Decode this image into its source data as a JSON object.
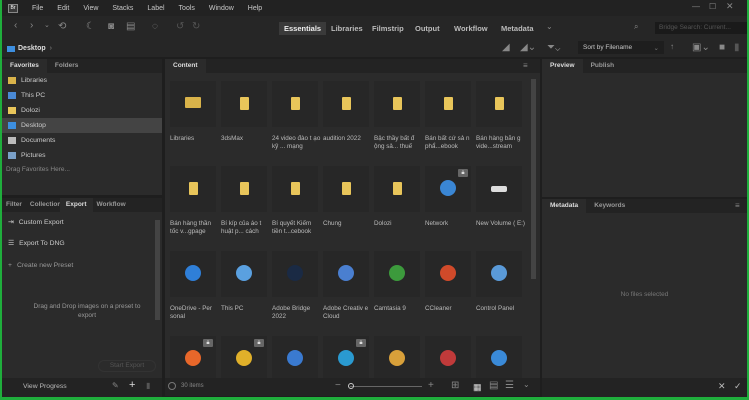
{
  "menu": [
    "File",
    "Edit",
    "View",
    "Stacks",
    "Label",
    "Tools",
    "Window",
    "Help"
  ],
  "workspaces": [
    "Essentials",
    "Libraries",
    "Filmstrip",
    "Output",
    "Workflow",
    "Metadata"
  ],
  "search_placeholder": "Bridge Search: Current...",
  "path": "Desktop",
  "sort": "Sort by Filename",
  "left_tabs": [
    "Favorites",
    "Folders"
  ],
  "favorites": [
    {
      "label": "Libraries",
      "color": "#d9b34a"
    },
    {
      "label": "This PC",
      "color": "#4a8ad6"
    },
    {
      "label": "Dolozi",
      "color": "#e8c55a"
    },
    {
      "label": "Desktop",
      "color": "#3d8fe0"
    },
    {
      "label": "Documents",
      "color": "#bbbbbb"
    },
    {
      "label": "Pictures",
      "color": "#7aa0c8"
    }
  ],
  "favorites_hint": "Drag Favorites Here...",
  "export_tabs": [
    "Filter",
    "Collection",
    "Export",
    "Workflow"
  ],
  "export_items": [
    "Custom Export",
    "Export To DNG",
    "Create new Preset"
  ],
  "export_hint": "Drag and Drop images on a preset to export",
  "start_export": "Start Export",
  "view_progress": "View Progress",
  "content_tab": "Content",
  "items": [
    {
      "label": "Libraries",
      "type": "libraries"
    },
    {
      "label": "3dsMax",
      "type": "folder"
    },
    {
      "label": "24 video đào t ạo kỹ ... mạng",
      "type": "folder"
    },
    {
      "label": "audition 2022",
      "type": "folder"
    },
    {
      "label": "Bậc thầy bất đ ộng sả... thuế",
      "type": "folder"
    },
    {
      "label": "Bán bất cứ sả n phẩ...ebook",
      "type": "folder"
    },
    {
      "label": "Bán hàng bằn g vide...stream",
      "type": "folder"
    },
    {
      "label": "Bán hàng thần tốc v...gpage",
      "type": "folder"
    },
    {
      "label": "Bí kíp của áo t huật p... cách",
      "type": "folder"
    },
    {
      "label": "Bí quyết Kiếm tiền t...cebook",
      "type": "folder"
    },
    {
      "label": "Chung",
      "type": "folder"
    },
    {
      "label": "Dolozi",
      "type": "folder"
    },
    {
      "label": "Network",
      "type": "app",
      "color": "#3a86d4",
      "lock": true
    },
    {
      "label": "New Volume ( E:)",
      "type": "drive"
    },
    {
      "label": "OneDrive - Per sonal",
      "type": "app",
      "color": "#2f7fd8"
    },
    {
      "label": "This PC",
      "type": "app",
      "color": "#5aa0e0"
    },
    {
      "label": "Adobe Bridge 2022",
      "type": "app",
      "color": "#1a2a44"
    },
    {
      "label": "Adobe Creativ e Cloud",
      "type": "app",
      "color": "#4a7fd0"
    },
    {
      "label": "Camtasia 9",
      "type": "app",
      "color": "#3c9a3c"
    },
    {
      "label": "CCleaner",
      "type": "app",
      "color": "#d04a2a"
    },
    {
      "label": "Control Panel",
      "type": "app",
      "color": "#5a9ad8"
    },
    {
      "label": "",
      "type": "app",
      "color": "#e8672a",
      "lock": true
    },
    {
      "label": "",
      "type": "app",
      "color": "#e0b02a",
      "lock": true
    },
    {
      "label": "",
      "type": "app",
      "color": "#3a7ad0"
    },
    {
      "label": "",
      "type": "app",
      "color": "#2a9ad0",
      "lock": true
    },
    {
      "label": "",
      "type": "app",
      "color": "#d8a03a"
    },
    {
      "label": "",
      "type": "app",
      "color": "#c03a3a"
    },
    {
      "label": "",
      "type": "app",
      "color": "#3a8ad8"
    }
  ],
  "item_count": "30 items",
  "right_tabs": [
    "Preview",
    "Publish"
  ],
  "meta_tabs": [
    "Metadata",
    "Keywords"
  ],
  "no_files": "No files selected"
}
